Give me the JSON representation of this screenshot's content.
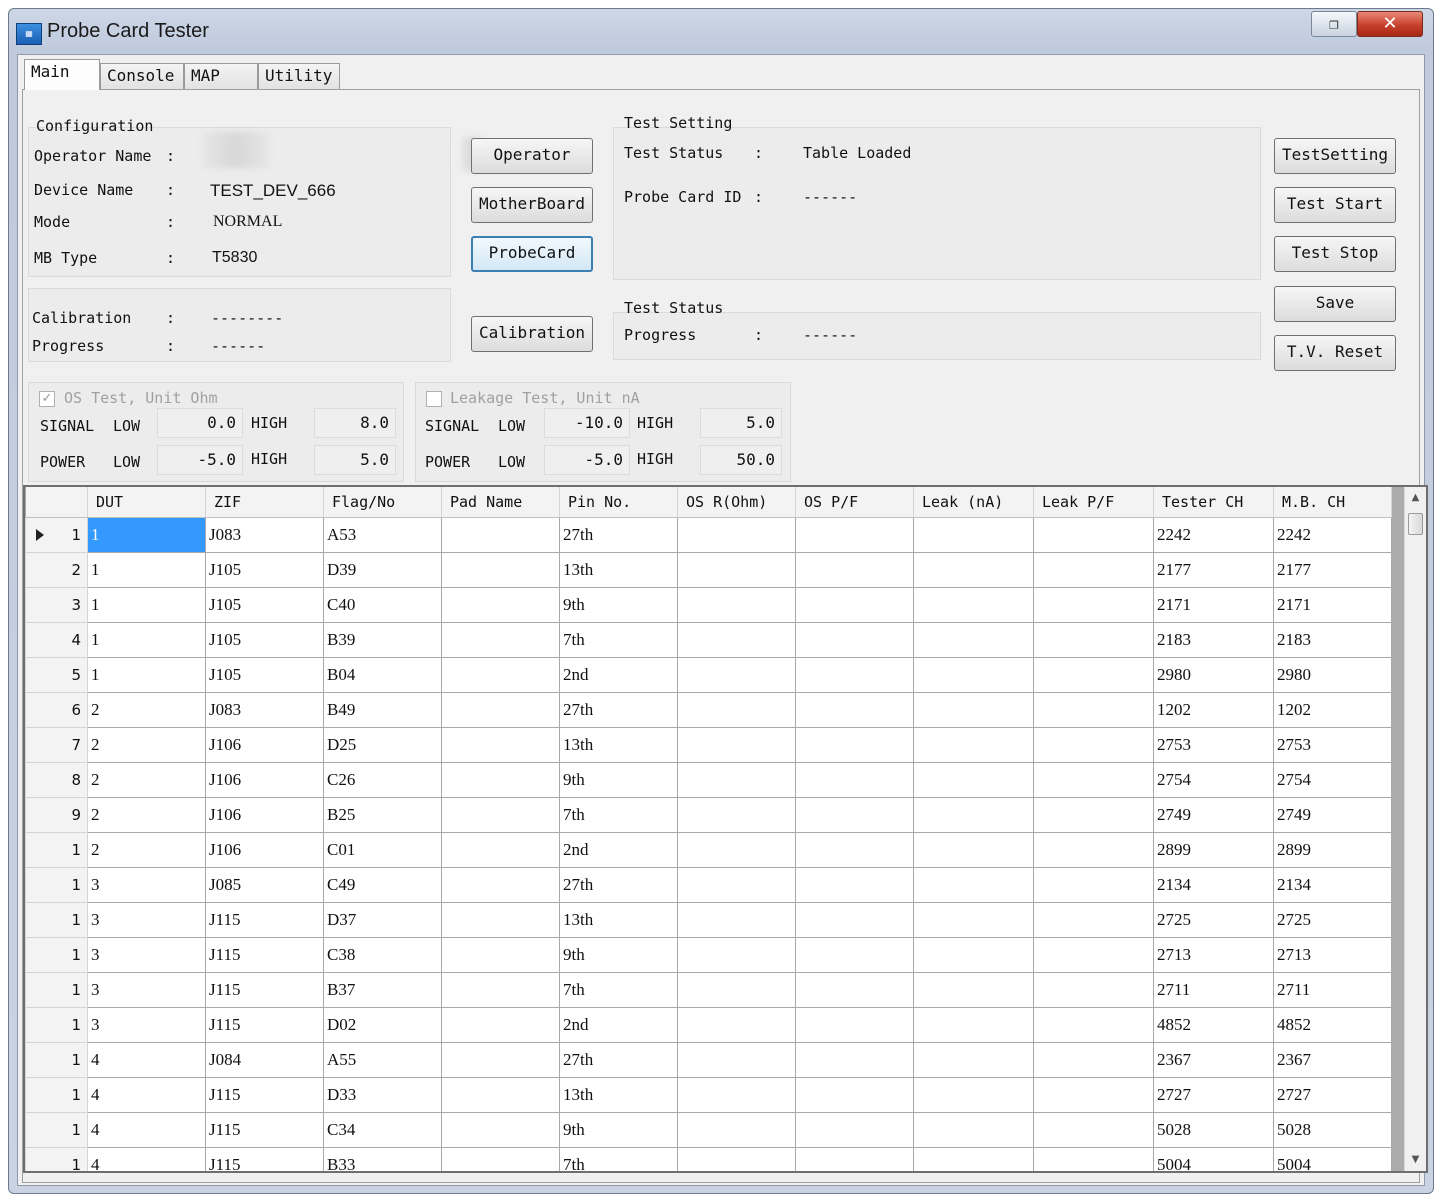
{
  "window": {
    "title": "Probe Card Tester",
    "restore_glyph": "❐",
    "close_glyph": "✕"
  },
  "tabs": [
    "Main",
    "Console",
    "MAP",
    "Utility"
  ],
  "config": {
    "title": "Configuration",
    "operator_label": "Operator Name",
    "colon": ":",
    "device_label": "Device Name",
    "device_value": "TEST_DEV_666",
    "mode_label": "Mode",
    "mode_value": "NORMAL",
    "mb_label": "MB Type",
    "mb_value": "T5830"
  },
  "calib": {
    "calibration_label": "Calibration",
    "calibration_value": "--------",
    "progress_label": "Progress",
    "progress_value": "------"
  },
  "buttons": {
    "operator": "Operator",
    "motherboard": "MotherBoard",
    "probecard": "ProbeCard",
    "calibration": "Calibration",
    "testsetting": "TestSetting",
    "test_start": "Test Start",
    "test_stop": "Test Stop",
    "save": "Save",
    "tv_reset": "T.V. Reset"
  },
  "test_setting": {
    "title": "Test Setting",
    "status_label": "Test Status",
    "status_value": "Table Loaded",
    "probe_id_label": "Probe Card ID",
    "probe_id_value": "------"
  },
  "test_status": {
    "title": "Test Status",
    "progress_label": "Progress",
    "progress_value": "------"
  },
  "os_test": {
    "label": "OS Test, Unit Ohm",
    "checked": true,
    "check_glyph": "✓",
    "signal": "SIGNAL",
    "power": "POWER",
    "low": "LOW",
    "high": "HIGH",
    "signal_low": "0.0",
    "signal_high": "8.0",
    "power_low": "-5.0",
    "power_high": "5.0"
  },
  "leak_test": {
    "label": "Leakage Test, Unit nA",
    "checked": false,
    "signal": "SIGNAL",
    "power": "POWER",
    "low": "LOW",
    "high": "HIGH",
    "signal_low": "-10.0",
    "signal_high": "5.0",
    "power_low": "-5.0",
    "power_high": "50.0"
  },
  "grid": {
    "columns": [
      "DUT",
      "ZIF",
      "Flag/No",
      "Pad Name",
      "Pin No.",
      "OS R(Ohm)",
      "OS P/F",
      "Leak (nA)",
      "Leak P/F",
      "Tester CH",
      "M.B. CH"
    ],
    "rows": [
      {
        "n": "1",
        "dut": "1",
        "zif": "J083",
        "flag": "A53",
        "pad": "",
        "pin": "27th",
        "osr": "",
        "ospf": "",
        "leak": "",
        "leakpf": "",
        "tch": "2242",
        "mbch": "2242"
      },
      {
        "n": "2",
        "dut": "1",
        "zif": "J105",
        "flag": "D39",
        "pad": "",
        "pin": "13th",
        "osr": "",
        "ospf": "",
        "leak": "",
        "leakpf": "",
        "tch": "2177",
        "mbch": "2177"
      },
      {
        "n": "3",
        "dut": "1",
        "zif": "J105",
        "flag": "C40",
        "pad": "",
        "pin": "9th",
        "osr": "",
        "ospf": "",
        "leak": "",
        "leakpf": "",
        "tch": "2171",
        "mbch": "2171"
      },
      {
        "n": "4",
        "dut": "1",
        "zif": "J105",
        "flag": "B39",
        "pad": "",
        "pin": "7th",
        "osr": "",
        "ospf": "",
        "leak": "",
        "leakpf": "",
        "tch": "2183",
        "mbch": "2183"
      },
      {
        "n": "5",
        "dut": "1",
        "zif": "J105",
        "flag": "B04",
        "pad": "",
        "pin": "2nd",
        "osr": "",
        "ospf": "",
        "leak": "",
        "leakpf": "",
        "tch": "2980",
        "mbch": "2980"
      },
      {
        "n": "6",
        "dut": "2",
        "zif": "J083",
        "flag": "B49",
        "pad": "",
        "pin": "27th",
        "osr": "",
        "ospf": "",
        "leak": "",
        "leakpf": "",
        "tch": "1202",
        "mbch": "1202"
      },
      {
        "n": "7",
        "dut": "2",
        "zif": "J106",
        "flag": "D25",
        "pad": "",
        "pin": "13th",
        "osr": "",
        "ospf": "",
        "leak": "",
        "leakpf": "",
        "tch": "2753",
        "mbch": "2753"
      },
      {
        "n": "8",
        "dut": "2",
        "zif": "J106",
        "flag": "C26",
        "pad": "",
        "pin": "9th",
        "osr": "",
        "ospf": "",
        "leak": "",
        "leakpf": "",
        "tch": "2754",
        "mbch": "2754"
      },
      {
        "n": "9",
        "dut": "2",
        "zif": "J106",
        "flag": "B25",
        "pad": "",
        "pin": "7th",
        "osr": "",
        "ospf": "",
        "leak": "",
        "leakpf": "",
        "tch": "2749",
        "mbch": "2749"
      },
      {
        "n": "1",
        "dut": "2",
        "zif": "J106",
        "flag": "C01",
        "pad": "",
        "pin": "2nd",
        "osr": "",
        "ospf": "",
        "leak": "",
        "leakpf": "",
        "tch": "2899",
        "mbch": "2899"
      },
      {
        "n": "1",
        "dut": "3",
        "zif": "J085",
        "flag": "C49",
        "pad": "",
        "pin": "27th",
        "osr": "",
        "ospf": "",
        "leak": "",
        "leakpf": "",
        "tch": "2134",
        "mbch": "2134"
      },
      {
        "n": "1",
        "dut": "3",
        "zif": "J115",
        "flag": "D37",
        "pad": "",
        "pin": "13th",
        "osr": "",
        "ospf": "",
        "leak": "",
        "leakpf": "",
        "tch": "2725",
        "mbch": "2725"
      },
      {
        "n": "1",
        "dut": "3",
        "zif": "J115",
        "flag": "C38",
        "pad": "",
        "pin": "9th",
        "osr": "",
        "ospf": "",
        "leak": "",
        "leakpf": "",
        "tch": "2713",
        "mbch": "2713"
      },
      {
        "n": "1",
        "dut": "3",
        "zif": "J115",
        "flag": "B37",
        "pad": "",
        "pin": "7th",
        "osr": "",
        "ospf": "",
        "leak": "",
        "leakpf": "",
        "tch": "2711",
        "mbch": "2711"
      },
      {
        "n": "1",
        "dut": "3",
        "zif": "J115",
        "flag": "D02",
        "pad": "",
        "pin": "2nd",
        "osr": "",
        "ospf": "",
        "leak": "",
        "leakpf": "",
        "tch": "4852",
        "mbch": "4852"
      },
      {
        "n": "1",
        "dut": "4",
        "zif": "J084",
        "flag": "A55",
        "pad": "",
        "pin": "27th",
        "osr": "",
        "ospf": "",
        "leak": "",
        "leakpf": "",
        "tch": "2367",
        "mbch": "2367"
      },
      {
        "n": "1",
        "dut": "4",
        "zif": "J115",
        "flag": "D33",
        "pad": "",
        "pin": "13th",
        "osr": "",
        "ospf": "",
        "leak": "",
        "leakpf": "",
        "tch": "2727",
        "mbch": "2727"
      },
      {
        "n": "1",
        "dut": "4",
        "zif": "J115",
        "flag": "C34",
        "pad": "",
        "pin": "9th",
        "osr": "",
        "ospf": "",
        "leak": "",
        "leakpf": "",
        "tch": "5028",
        "mbch": "5028"
      },
      {
        "n": "1",
        "dut": "4",
        "zif": "J115",
        "flag": "B33",
        "pad": "",
        "pin": "7th",
        "osr": "",
        "ospf": "",
        "leak": "",
        "leakpf": "",
        "tch": "5004",
        "mbch": "5004"
      }
    ],
    "scroll_up": "▲",
    "scroll_down": "▼"
  },
  "colors": {
    "selection": "#3399ff",
    "focus_border": "#3c7fb1",
    "close_red": "#c7412c"
  }
}
